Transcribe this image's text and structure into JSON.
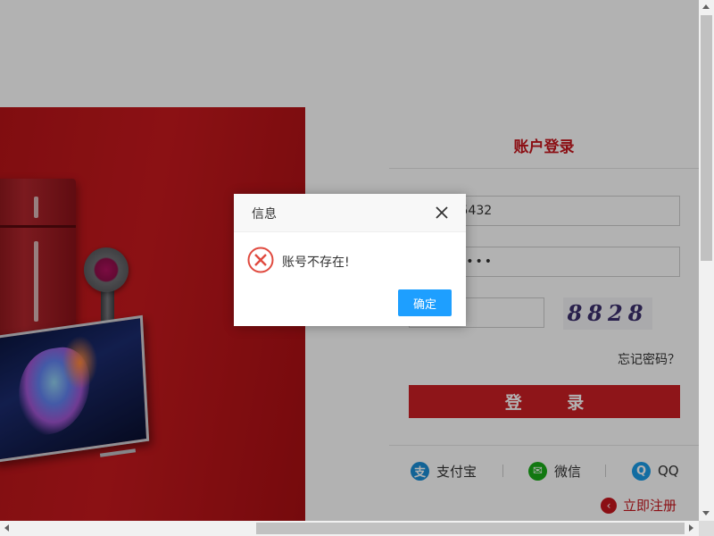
{
  "login": {
    "title": "账户登录",
    "username_value": "598765432",
    "password_value": "••••••••",
    "captcha_text": "8828",
    "forgot_link": "忘记密码？",
    "submit_label": "登 录",
    "social": [
      {
        "label": "支付宝",
        "icon": "alipay-icon",
        "glyph": "支",
        "color": "#1a8ed7"
      },
      {
        "label": "微信",
        "icon": "wechat-icon",
        "glyph": "✉",
        "color": "#1aad19"
      },
      {
        "label": "QQ",
        "icon": "qq-icon",
        "glyph": "Q",
        "color": "#1b9ce8"
      }
    ],
    "register_link": "立即注册",
    "register_icon": "chevron-left-icon"
  },
  "dialog": {
    "title": "信息",
    "message": "账号不存在!",
    "ok_label": "确定",
    "icon": "error-x-icon",
    "error_color": "#e04a3f",
    "button_color": "#1e9fff"
  },
  "theme": {
    "brand_red": "#c8161d",
    "overlay": "rgba(0,0,0,0.3)"
  }
}
